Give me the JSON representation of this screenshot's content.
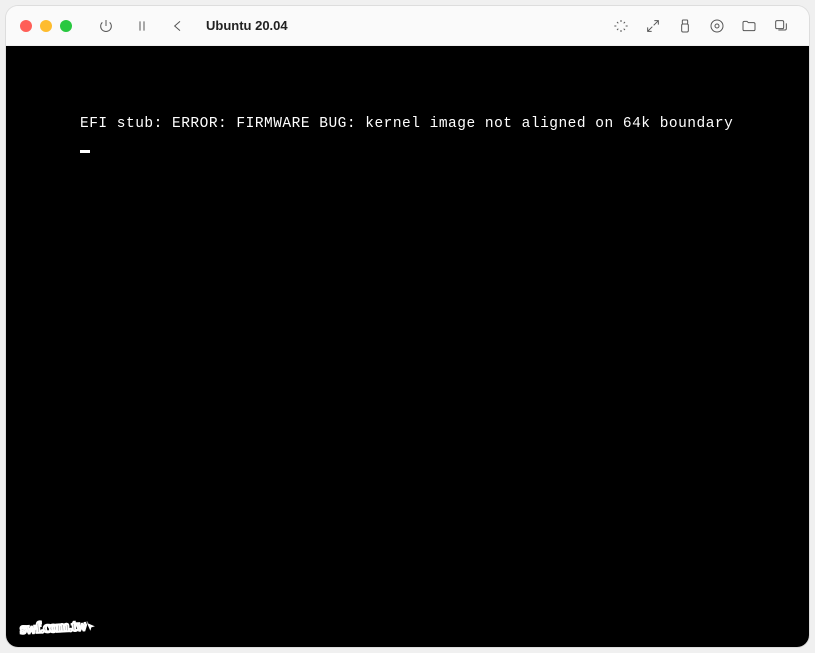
{
  "window": {
    "title": "Ubuntu 20.04"
  },
  "terminal": {
    "line1": "EFI stub: ERROR: FIRMWARE BUG: kernel image not aligned on 64k boundary"
  },
  "watermark": {
    "text": "swf.com.tw"
  }
}
